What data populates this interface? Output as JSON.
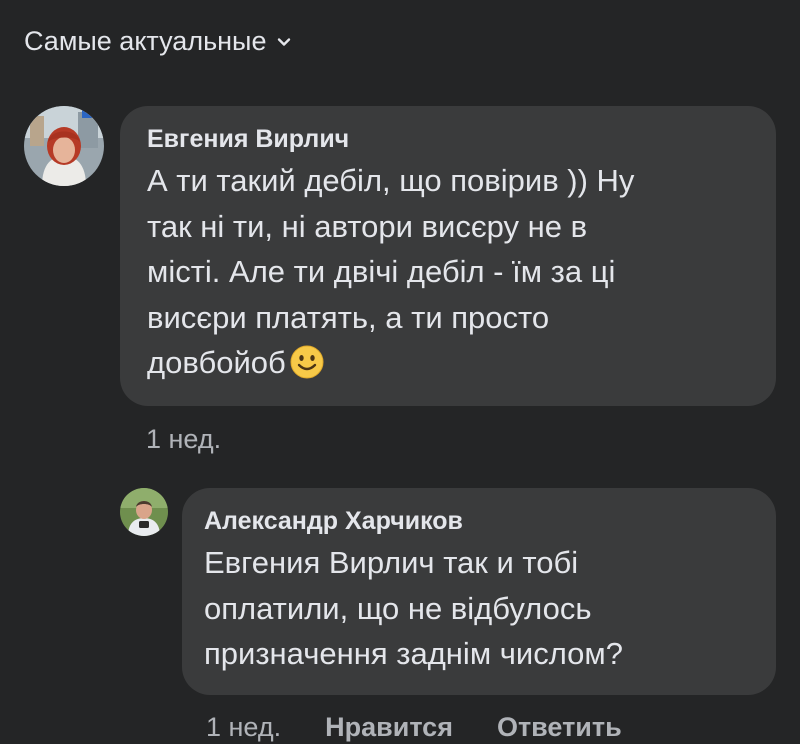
{
  "sort": {
    "label": "Самые актуальные",
    "icon": "chevron-down-icon"
  },
  "comments": [
    {
      "author": "Евгения Вирлич",
      "text_lines": [
        "А ти такий дебіл, що повірив )) Ну",
        "так ні ти, ні автори висєру не в",
        "місті. Але ти двічі дебіл - їм за ці",
        "висєри платять, а ти просто",
        "довбойоб"
      ],
      "emoji": "slightly-smiling-face-icon",
      "time": "1 нед."
    },
    {
      "author": "Александр Харчиков",
      "text_lines": [
        "Евгения Вирлич так и тобі",
        "оплатили, що не відбулось",
        "призначення заднім числом?"
      ],
      "time": "1 нед.",
      "like_label": "Нравится",
      "reply_label": "Ответить"
    }
  ],
  "colors": {
    "background": "#242526",
    "bubble": "#3a3b3c",
    "text": "#e4e6eb",
    "secondary_text": "#b0b3b8",
    "emoji_face": "#f7c948"
  }
}
